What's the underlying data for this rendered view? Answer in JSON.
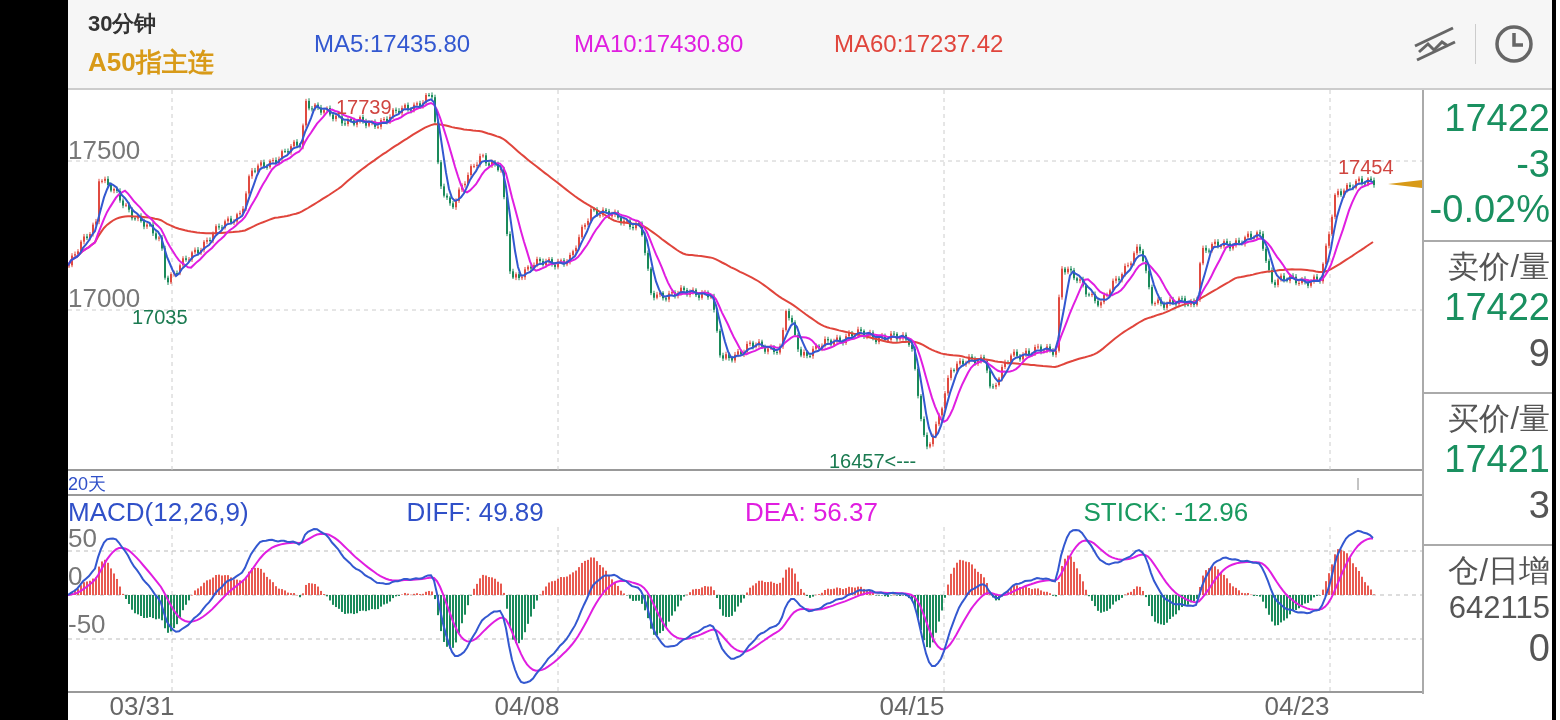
{
  "header": {
    "period": "30分钟",
    "instrument": "A50指主连",
    "indicators": [
      {
        "label": "MA5:17435.80",
        "color": "#3358d0"
      },
      {
        "label": "MA10:17430.80",
        "color": "#e01ee0"
      },
      {
        "label": "MA60:17237.42",
        "color": "#e0453c"
      }
    ]
  },
  "price_chart": {
    "y_labels": [
      "17500",
      "17000"
    ],
    "high_label": "17739",
    "low_label": "17035",
    "min_label": "16457<---",
    "last_label": "17454",
    "range_label": "20天"
  },
  "macd": {
    "title": "MACD(12,26,9)",
    "diff": "DIFF: 49.89",
    "dea": "DEA: 56.37",
    "stick": "STICK: -12.96",
    "y_labels": [
      "50",
      "0",
      "-50"
    ]
  },
  "x_labels": [
    "03/31",
    "04/08",
    "04/15",
    "04/23"
  ],
  "quote": {
    "price": "17422",
    "change": "-3",
    "change_pct": "-0.02%",
    "sections": [
      {
        "label": "卖价/量",
        "price": "17422",
        "volume": "9"
      },
      {
        "label": "买价/量",
        "price": "17421",
        "volume": "3"
      }
    ],
    "open_interest": {
      "label": "仓/日增",
      "value": "642115",
      "change": "0"
    }
  }
}
